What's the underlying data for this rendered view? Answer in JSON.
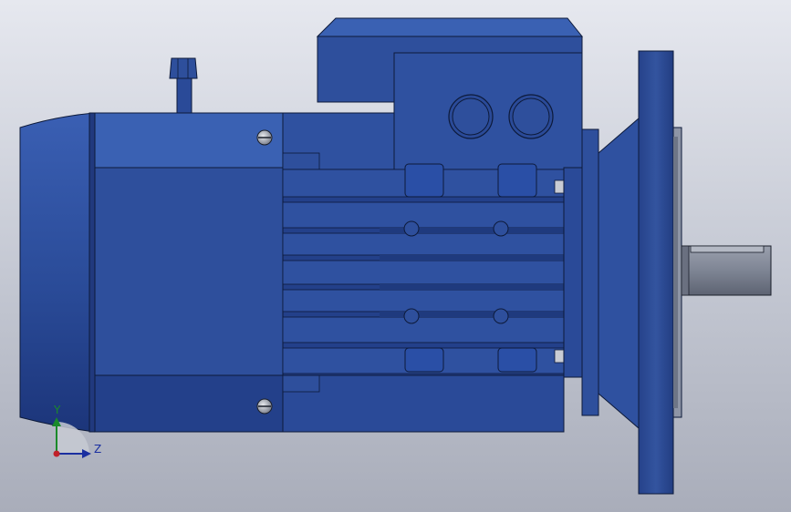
{
  "viewport": {
    "background_top": "#e6e8ef",
    "background_bottom": "#a9adba"
  },
  "model": {
    "colors": {
      "body": "#2e4f9c",
      "body_light": "#3a61b3",
      "body_dark": "#1f3a7e",
      "edge": "#0d1a3a",
      "shaft": "#7e8594"
    }
  },
  "triad": {
    "y_label": "Y",
    "z_label": "Z",
    "y_color": "#1a8a2a",
    "z_color": "#1a2fa0",
    "origin_color": "#c0202a"
  }
}
